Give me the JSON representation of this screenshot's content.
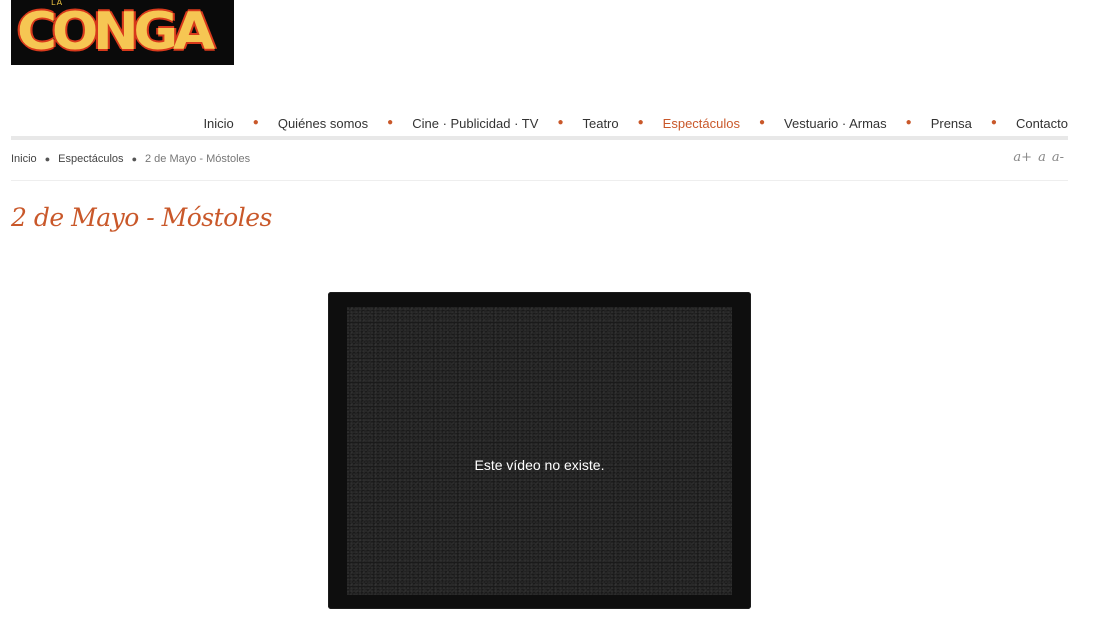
{
  "logo": {
    "small_text": "LA",
    "word": "CONGA"
  },
  "nav": {
    "items": [
      {
        "label": "Inicio"
      },
      {
        "label": "Quiénes somos"
      },
      {
        "label": "Cine · Publicidad · TV"
      },
      {
        "label": "Teatro"
      },
      {
        "label": "Espectáculos",
        "active": true
      },
      {
        "label": "Vestuario · Armas"
      },
      {
        "label": "Prensa"
      },
      {
        "label": "Contacto"
      }
    ],
    "separator": "●"
  },
  "breadcrumb": {
    "items": [
      "Inicio",
      "Espectáculos",
      "2 de Mayo - Móstoles"
    ],
    "separator": "●"
  },
  "font_size_tools": {
    "increase": "a+",
    "reset": "a",
    "decrease": "a-"
  },
  "page": {
    "title": "2 de Mayo - Móstoles"
  },
  "video": {
    "message": "Este vídeo no existe."
  },
  "colors": {
    "accent": "#c9582a",
    "logo_fill": "#f6c653",
    "logo_outline": "#d8391b"
  }
}
